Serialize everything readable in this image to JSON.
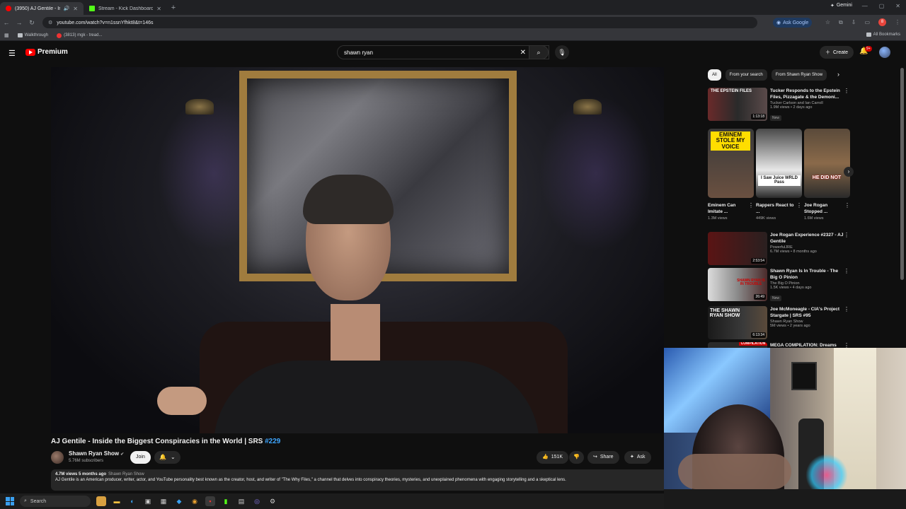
{
  "browser": {
    "tabs": [
      {
        "title": "(3950) AJ Gentile - Inside th",
        "active": true,
        "favicon_color": "#ff0000"
      },
      {
        "title": "Stream - Kick Dashboard",
        "active": false,
        "favicon_color": "#53fc18"
      }
    ],
    "new_tab": "+",
    "gemini_label": "Gemini",
    "url": "youtube.com/watch?v=n1ssnYfhkt8&t=146s",
    "ask_google_label": "Ask Google",
    "bookmarks": [
      {
        "label": "Walkthrough",
        "icon": "folder-icon"
      },
      {
        "label": "(3813) mgk - tread...",
        "icon": "youtube-icon"
      }
    ],
    "all_bookmarks_label": "All Bookmarks",
    "profile_initial": "8"
  },
  "youtube": {
    "logo_label": "Premium",
    "search_query": "shawn ryan",
    "create_label": "Create",
    "notif_count": "9+",
    "accent_color": "#ff0000",
    "link_color": "#3ea6ff"
  },
  "video": {
    "title_main": "AJ Gentile - Inside the Biggest Conspiracies in the World | SRS ",
    "title_tag": "#229",
    "channel": "Shawn Ryan Show",
    "subscribers": "5.76M subscribers",
    "join_label": "Join",
    "likes": "151K",
    "share_label": "Share",
    "ask_label": "Ask",
    "views_date": "4.7M views  5 months ago",
    "channel_tag": "Shawn Ryan Show",
    "description": "AJ Gentile is an American producer, writer, actor, and YouTube personality best known as the creator, host, and writer of \"The Why Files,\" a channel that delves into conspiracy theories, mysteries, and unexplained phenomena with engaging storytelling and a skeptical lens."
  },
  "sidebar": {
    "chips": [
      "All",
      "From your search",
      "From Shawn Ryan Show"
    ],
    "recs": [
      {
        "title": "Tucker Responds to the Epstein Files, Pizzagate & the Demoni...",
        "channel": "Tucker Carlson and Ian Carroll",
        "views": "1.9M views • 2 days ago",
        "badge": "New",
        "duration": "1:13:18",
        "thumb_text": "THE EPSTEIN FILES"
      },
      {
        "title": "Joe Rogan Experience #2327 - AJ Gentile",
        "channel": "PowerfulJRE",
        "views": "6.7M views • 8 months ago",
        "badge": "",
        "duration": "2:53:54",
        "thumb_text": ""
      },
      {
        "title": "Shawn Ryan Is In Trouble - The Big O Pinion",
        "channel": "The Big O Pinion",
        "views": "1.5K views • 4 days ago",
        "badge": "New",
        "duration": "26:49",
        "thumb_text": "SHAWN RYAN IS IN TROUBLE"
      },
      {
        "title": "Joe McMoneagle - CIA's Project Stargate | SRS #95",
        "channel": "Shawn Ryan Show",
        "views": "5M views • 2 years ago",
        "badge": "",
        "duration": "6:13:34",
        "thumb_text": "THE SHAWN RYAN SHOW"
      },
      {
        "title": "MEGA COMPILATION: Dreams",
        "channel": "",
        "views": "",
        "badge": "",
        "duration": "",
        "thumb_text": "COMPILATION"
      }
    ],
    "shorts": [
      {
        "title": "Eminem Can Imitate ...",
        "views": "1.3M views",
        "overlay": "EMINEM STOLE MY VOICE"
      },
      {
        "title": "Rappers React to ...",
        "views": "449K views",
        "overlay": "I Saw Juice WRLD Pass"
      },
      {
        "title": "Joe Rogan Stopped ...",
        "views": "1.6M views",
        "overlay": "HE DID NOT"
      }
    ]
  },
  "taskbar": {
    "search_label": "Search"
  }
}
